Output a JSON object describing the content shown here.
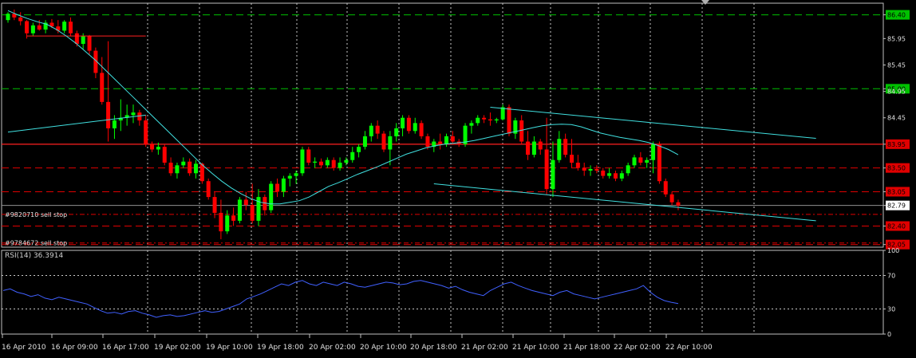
{
  "chart_data": [
    {
      "type": "candlestick",
      "title": "",
      "symbol_line": "",
      "y_axis": {
        "ylim": [
          82.0,
          86.62
        ],
        "tick_labels": [
          "86.40",
          "85.95",
          "85.45",
          "85.00",
          "84.95",
          "84.45",
          "83.95",
          "83.50",
          "83.05",
          "82.79",
          "82.40",
          "82.05"
        ],
        "tick_values": [
          86.4,
          85.95,
          85.45,
          85.0,
          84.95,
          84.45,
          83.95,
          83.5,
          83.05,
          82.79,
          82.4,
          82.05
        ]
      },
      "highlighted_price_labels": [
        {
          "value": 86.4,
          "text": "86.40",
          "color": "#00c000"
        },
        {
          "value": 85.0,
          "text": "85.00",
          "color": "#00c000"
        },
        {
          "value": 83.95,
          "text": "83.95",
          "color": "#e00000"
        },
        {
          "value": 83.5,
          "text": "83.50",
          "color": "#e00000"
        },
        {
          "value": 83.05,
          "text": "83.05",
          "color": "#e00000"
        },
        {
          "value": 82.4,
          "text": "82.40",
          "color": "#e00000"
        },
        {
          "value": 82.05,
          "text": "82.05",
          "color": "#e00000"
        }
      ],
      "current_price": {
        "value": 82.79,
        "text": "82.79"
      },
      "x_axis": {
        "tick_labels": [
          "16 Apr 2010",
          "16 Apr 09:00",
          "16 Apr 17:00",
          "19 Apr 02:00",
          "19 Apr 10:00",
          "19 Apr 18:00",
          "20 Apr 02:00",
          "20 Apr 10:00",
          "20 Apr 18:00",
          "21 Apr 02:00",
          "21 Apr 10:00",
          "21 Apr 18:00",
          "22 Apr 02:00",
          "22 Apr 10:00"
        ]
      },
      "horizontal_levels": [
        {
          "value": 86.4,
          "color": "#00c000",
          "style": "dashed"
        },
        {
          "value": 85.0,
          "color": "#00c000",
          "style": "dashed"
        },
        {
          "value": 83.95,
          "color": "#ff2020",
          "style": "solid"
        },
        {
          "value": 83.5,
          "color": "#e00000",
          "style": "dashed"
        },
        {
          "value": 83.05,
          "color": "#e00000",
          "style": "dashed"
        },
        {
          "value": 82.4,
          "color": "#e00000",
          "style": "dashed"
        },
        {
          "value": 82.05,
          "color": "#e00000",
          "style": "dashed"
        }
      ],
      "orders": [
        {
          "label": "#9820710 sell stop",
          "value": 82.62
        },
        {
          "label": "#9784672 sell stop",
          "value": 82.08
        }
      ],
      "bull_color": "#00ff00",
      "bear_color": "#ff0000",
      "ma_color": "#40e0e0",
      "trendline_color": "#40e0e0",
      "candles": [
        [
          86.3,
          86.45,
          86.25,
          86.42
        ],
        [
          86.42,
          86.5,
          86.3,
          86.35
        ],
        [
          86.35,
          86.45,
          86.2,
          86.28
        ],
        [
          86.28,
          86.3,
          85.95,
          86.05
        ],
        [
          86.05,
          86.25,
          86.0,
          86.2
        ],
        [
          86.2,
          86.3,
          86.1,
          86.12
        ],
        [
          86.12,
          86.3,
          86.05,
          86.25
        ],
        [
          86.25,
          86.32,
          86.15,
          86.18
        ],
        [
          86.18,
          86.3,
          86.05,
          86.1
        ],
        [
          86.1,
          86.3,
          86.05,
          86.27
        ],
        [
          86.27,
          86.35,
          86.0,
          86.05
        ],
        [
          86.05,
          86.1,
          85.8,
          85.85
        ],
        [
          85.85,
          86.05,
          85.75,
          86.0
        ],
        [
          86.0,
          86.02,
          85.65,
          85.72
        ],
        [
          85.72,
          85.78,
          85.2,
          85.3
        ],
        [
          85.3,
          85.6,
          84.7,
          84.75
        ],
        [
          84.75,
          85.9,
          84.0,
          84.25
        ],
        [
          84.25,
          84.5,
          84.05,
          84.4
        ],
        [
          84.4,
          84.8,
          84.2,
          84.45
        ],
        [
          84.45,
          84.7,
          84.3,
          84.5
        ],
        [
          84.5,
          84.7,
          84.35,
          84.55
        ],
        [
          84.55,
          84.6,
          84.3,
          84.4
        ],
        [
          84.4,
          84.5,
          83.9,
          83.95
        ],
        [
          83.95,
          84.0,
          83.8,
          83.85
        ],
        [
          83.85,
          83.98,
          83.75,
          83.9
        ],
        [
          83.9,
          83.95,
          83.55,
          83.6
        ],
        [
          83.6,
          83.7,
          83.35,
          83.4
        ],
        [
          83.4,
          83.6,
          83.3,
          83.55
        ],
        [
          83.55,
          83.7,
          83.5,
          83.62
        ],
        [
          83.62,
          83.68,
          83.35,
          83.4
        ],
        [
          83.4,
          83.65,
          83.3,
          83.58
        ],
        [
          83.58,
          83.6,
          83.2,
          83.25
        ],
        [
          83.25,
          83.3,
          82.9,
          82.95
        ],
        [
          82.95,
          83.05,
          82.55,
          82.65
        ],
        [
          82.65,
          82.9,
          82.15,
          82.3
        ],
        [
          82.3,
          82.7,
          82.25,
          82.6
        ],
        [
          82.6,
          82.75,
          82.4,
          82.5
        ],
        [
          82.5,
          82.95,
          82.45,
          82.9
        ],
        [
          82.9,
          83.05,
          82.7,
          82.8
        ],
        [
          82.8,
          83.2,
          82.45,
          82.5
        ],
        [
          82.5,
          83.1,
          82.4,
          82.95
        ],
        [
          82.95,
          83.0,
          82.6,
          82.7
        ],
        [
          82.7,
          83.25,
          82.65,
          83.2
        ],
        [
          83.2,
          83.3,
          82.95,
          83.05
        ],
        [
          83.05,
          83.35,
          82.95,
          83.3
        ],
        [
          83.3,
          83.4,
          83.15,
          83.35
        ],
        [
          83.35,
          83.45,
          83.2,
          83.4
        ],
        [
          83.4,
          83.9,
          83.35,
          83.85
        ],
        [
          83.85,
          83.9,
          83.55,
          83.6
        ],
        [
          83.6,
          83.7,
          83.5,
          83.62
        ],
        [
          83.62,
          83.68,
          83.5,
          83.55
        ],
        [
          83.55,
          83.7,
          83.5,
          83.65
        ],
        [
          83.65,
          83.7,
          83.45,
          83.5
        ],
        [
          83.5,
          83.7,
          83.45,
          83.6
        ],
        [
          83.6,
          83.7,
          83.55,
          83.65
        ],
        [
          83.65,
          83.9,
          83.6,
          83.8
        ],
        [
          83.8,
          83.95,
          83.7,
          83.9
        ],
        [
          83.9,
          84.2,
          83.85,
          84.1
        ],
        [
          84.1,
          84.35,
          84.0,
          84.3
        ],
        [
          84.3,
          84.4,
          84.05,
          84.15
        ],
        [
          84.15,
          84.2,
          83.8,
          83.85
        ],
        [
          83.85,
          84.2,
          83.55,
          84.1
        ],
        [
          84.1,
          84.35,
          84.0,
          84.25
        ],
        [
          84.25,
          84.5,
          84.1,
          84.45
        ],
        [
          84.45,
          84.5,
          84.15,
          84.2
        ],
        [
          84.2,
          84.45,
          84.15,
          84.35
        ],
        [
          84.35,
          84.4,
          84.05,
          84.1
        ],
        [
          84.1,
          84.15,
          83.85,
          83.9
        ],
        [
          83.9,
          84.05,
          83.8,
          84.0
        ],
        [
          84.0,
          84.15,
          83.85,
          83.95
        ],
        [
          83.95,
          84.15,
          83.9,
          84.1
        ],
        [
          84.1,
          84.2,
          83.95,
          84.0
        ],
        [
          84.0,
          84.05,
          83.9,
          83.95
        ],
        [
          83.95,
          84.35,
          83.9,
          84.3
        ],
        [
          84.3,
          84.4,
          84.15,
          84.35
        ],
        [
          84.35,
          84.5,
          84.3,
          84.45
        ],
        [
          84.45,
          84.5,
          84.35,
          84.42
        ],
        [
          84.42,
          84.55,
          84.3,
          84.4
        ],
        [
          84.4,
          84.45,
          84.35,
          84.42
        ],
        [
          84.42,
          84.7,
          84.4,
          84.65
        ],
        [
          84.65,
          84.7,
          84.1,
          84.15
        ],
        [
          84.15,
          84.45,
          84.05,
          84.4
        ],
        [
          84.4,
          84.5,
          83.95,
          84.0
        ],
        [
          84.0,
          84.2,
          83.65,
          83.75
        ],
        [
          83.75,
          84.1,
          83.7,
          84.0
        ],
        [
          84.0,
          84.05,
          83.75,
          83.85
        ],
        [
          83.85,
          84.45,
          83.0,
          83.1
        ],
        [
          83.1,
          84.0,
          82.95,
          83.65
        ],
        [
          83.65,
          84.2,
          83.6,
          84.05
        ],
        [
          84.05,
          84.15,
          83.7,
          83.75
        ],
        [
          83.75,
          84.05,
          83.5,
          83.6
        ],
        [
          83.6,
          83.75,
          83.45,
          83.5
        ],
        [
          83.5,
          83.6,
          83.35,
          83.45
        ],
        [
          83.45,
          83.55,
          83.35,
          83.48
        ],
        [
          83.48,
          83.55,
          83.4,
          83.45
        ],
        [
          83.45,
          83.5,
          83.3,
          83.35
        ],
        [
          83.35,
          83.5,
          83.3,
          83.4
        ],
        [
          83.4,
          83.45,
          83.25,
          83.3
        ],
        [
          83.3,
          83.45,
          83.25,
          83.4
        ],
        [
          83.4,
          83.6,
          83.35,
          83.55
        ],
        [
          83.55,
          83.75,
          83.5,
          83.7
        ],
        [
          83.7,
          83.8,
          83.55,
          83.6
        ],
        [
          83.6,
          83.7,
          83.5,
          83.65
        ],
        [
          83.65,
          84.0,
          83.4,
          83.95
        ],
        [
          83.95,
          84.0,
          83.2,
          83.25
        ],
        [
          83.25,
          83.3,
          82.95,
          83.0
        ],
        [
          83.0,
          83.05,
          82.8,
          82.85
        ],
        [
          82.85,
          82.9,
          82.7,
          82.79
        ]
      ],
      "ma": [
        86.48,
        86.4,
        86.33,
        86.27,
        86.22,
        86.12,
        86.0,
        85.86,
        85.7,
        85.54,
        85.36,
        85.18,
        85.0,
        84.82,
        84.64,
        84.46,
        84.28,
        84.1,
        83.92,
        83.74,
        83.56,
        83.4,
        83.25,
        83.12,
        83.01,
        82.92,
        82.85,
        82.82,
        82.82,
        82.85,
        82.88,
        82.95,
        83.05,
        83.15,
        83.22,
        83.3,
        83.38,
        83.45,
        83.52,
        83.6,
        83.68,
        83.76,
        83.82,
        83.88,
        83.92,
        83.95,
        83.97,
        83.99,
        84.02,
        84.06,
        84.1,
        84.14,
        84.18,
        84.22,
        84.26,
        84.3,
        84.32,
        84.33,
        84.32,
        84.28,
        84.22,
        84.16,
        84.12,
        84.08,
        84.05,
        84.02,
        83.98,
        83.92,
        83.85,
        83.75
      ],
      "trendlines": [
        {
          "from": [
            77,
            84.65
          ],
          "to": [
            129,
            84.06
          ]
        },
        {
          "from": [
            68,
            83.2
          ],
          "to": [
            129,
            82.5
          ]
        },
        {
          "from": [
            0,
            84.18
          ],
          "to": [
            22,
            84.5
          ]
        },
        {
          "from": [
            3,
            86.0
          ],
          "to": [
            22,
            86.0
          ],
          "color": "#ff2020"
        }
      ]
    },
    {
      "type": "line",
      "title": "RSI(14) 36.3914",
      "ylim": [
        0,
        100
      ],
      "tick_labels": [
        "100",
        "70",
        "30",
        "0"
      ],
      "tick_values": [
        100,
        70,
        30,
        0
      ],
      "levels": [
        70,
        30
      ],
      "series": [
        {
          "color": "#4060ff",
          "values": [
            52,
            54,
            50,
            48,
            45,
            47,
            43,
            41,
            44,
            42,
            40,
            38,
            36,
            32,
            28,
            25,
            26,
            24,
            27,
            28,
            25,
            23,
            20,
            22,
            23,
            21,
            22,
            24,
            26,
            28,
            26,
            27,
            30,
            33,
            36,
            42,
            45,
            48,
            52,
            56,
            60,
            58,
            62,
            64,
            60,
            58,
            62,
            60,
            58,
            62,
            60,
            57,
            56,
            58,
            60,
            62,
            61,
            59,
            60,
            63,
            64,
            62,
            60,
            58,
            55,
            57,
            53,
            50,
            48,
            46,
            52,
            56,
            60,
            62,
            58,
            55,
            52,
            50,
            48,
            46,
            50,
            52,
            48,
            46,
            44,
            42,
            44,
            46,
            48,
            50,
            52,
            54,
            58,
            50,
            44,
            40,
            38,
            36.39
          ]
        }
      ]
    }
  ]
}
